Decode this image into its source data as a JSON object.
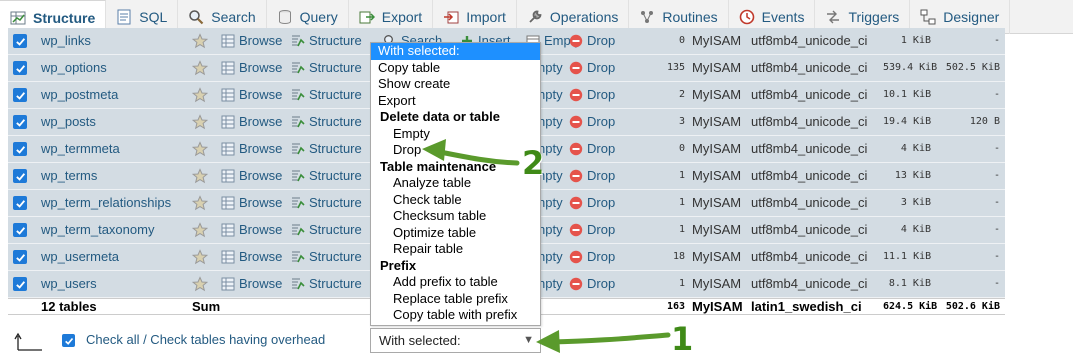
{
  "tabs": [
    {
      "label": "Structure",
      "icon": "structure-icon",
      "active": true
    },
    {
      "label": "SQL",
      "icon": "sql-icon"
    },
    {
      "label": "Search",
      "icon": "search-icon"
    },
    {
      "label": "Query",
      "icon": "query-icon"
    },
    {
      "label": "Export",
      "icon": "export-icon"
    },
    {
      "label": "Import",
      "icon": "import-icon"
    },
    {
      "label": "Operations",
      "icon": "wrench-icon"
    },
    {
      "label": "Routines",
      "icon": "routines-icon"
    },
    {
      "label": "Events",
      "icon": "clock-icon"
    },
    {
      "label": "Triggers",
      "icon": "triggers-icon"
    },
    {
      "label": "Designer",
      "icon": "designer-icon"
    }
  ],
  "actions": {
    "browse": "Browse",
    "structure": "Structure",
    "search": "Search",
    "insert": "Insert",
    "empty": "Empty",
    "drop": "Drop",
    "empty_partial": "npty"
  },
  "tables": [
    {
      "name": "wp_links",
      "rows": "0",
      "engine": "MyISAM",
      "collation": "utf8mb4_unicode_ci",
      "size": "1 KiB",
      "overhead": "-"
    },
    {
      "name": "wp_options",
      "rows": "135",
      "engine": "MyISAM",
      "collation": "utf8mb4_unicode_ci",
      "size": "539.4 KiB",
      "overhead": "502.5 KiB"
    },
    {
      "name": "wp_postmeta",
      "rows": "2",
      "engine": "MyISAM",
      "collation": "utf8mb4_unicode_ci",
      "size": "10.1 KiB",
      "overhead": "-"
    },
    {
      "name": "wp_posts",
      "rows": "3",
      "engine": "MyISAM",
      "collation": "utf8mb4_unicode_ci",
      "size": "19.4 KiB",
      "overhead": "120 B"
    },
    {
      "name": "wp_termmeta",
      "rows": "0",
      "engine": "MyISAM",
      "collation": "utf8mb4_unicode_ci",
      "size": "4 KiB",
      "overhead": "-"
    },
    {
      "name": "wp_terms",
      "rows": "1",
      "engine": "MyISAM",
      "collation": "utf8mb4_unicode_ci",
      "size": "13 KiB",
      "overhead": "-"
    },
    {
      "name": "wp_term_relationships",
      "rows": "1",
      "engine": "MyISAM",
      "collation": "utf8mb4_unicode_ci",
      "size": "3 KiB",
      "overhead": "-"
    },
    {
      "name": "wp_term_taxonomy",
      "rows": "1",
      "engine": "MyISAM",
      "collation": "utf8mb4_unicode_ci",
      "size": "4 KiB",
      "overhead": "-"
    },
    {
      "name": "wp_usermeta",
      "rows": "18",
      "engine": "MyISAM",
      "collation": "utf8mb4_unicode_ci",
      "size": "11.1 KiB",
      "overhead": "-"
    },
    {
      "name": "wp_users",
      "rows": "1",
      "engine": "MyISAM",
      "collation": "utf8mb4_unicode_ci",
      "size": "8.1 KiB",
      "overhead": "-"
    }
  ],
  "summary": {
    "count": "12 tables",
    "sum": "Sum",
    "rows": "163",
    "engine": "MyISAM",
    "collation": "latin1_swedish_ci",
    "size": "624.5 KiB",
    "overhead": "502.6 KiB"
  },
  "dropdown": {
    "items": [
      {
        "label": "With selected:",
        "kind": "selected"
      },
      {
        "label": "Copy table",
        "kind": "item"
      },
      {
        "label": "Show create",
        "kind": "item"
      },
      {
        "label": "Export",
        "kind": "item"
      },
      {
        "label": "Delete data or table",
        "kind": "group"
      },
      {
        "label": "Empty",
        "kind": "sub"
      },
      {
        "label": "Drop",
        "kind": "sub"
      },
      {
        "label": "Table maintenance",
        "kind": "group"
      },
      {
        "label": "Analyze table",
        "kind": "sub"
      },
      {
        "label": "Check table",
        "kind": "sub"
      },
      {
        "label": "Checksum table",
        "kind": "sub"
      },
      {
        "label": "Optimize table",
        "kind": "sub"
      },
      {
        "label": "Repair table",
        "kind": "sub"
      },
      {
        "label": "Prefix",
        "kind": "group"
      },
      {
        "label": "Add prefix to table",
        "kind": "sub"
      },
      {
        "label": "Replace table prefix",
        "kind": "sub"
      },
      {
        "label": "Copy table with prefix",
        "kind": "sub"
      }
    ]
  },
  "footer": {
    "check_all_label": "Check all / Check tables having overhead",
    "select_value": "With selected:"
  },
  "annotations": {
    "step1": "1",
    "step2": "2",
    "arrow_color": "#5a9a2c"
  },
  "colors": {
    "link": "#235a81",
    "row_bg": "#d3dce3",
    "checkbox": "#1e7ad8",
    "drop_icon": "#e5534b",
    "selected_option": "#1e90ff"
  }
}
